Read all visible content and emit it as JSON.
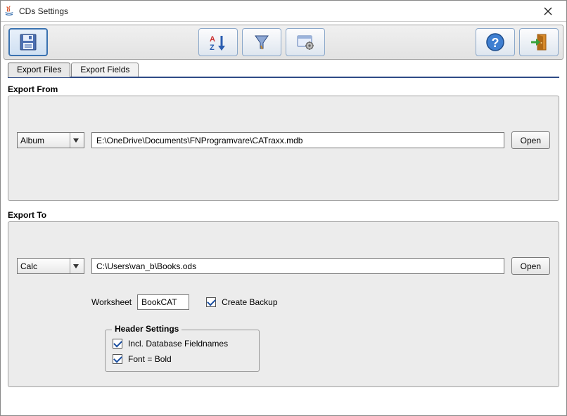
{
  "window": {
    "title": "CDs Settings"
  },
  "toolbar": {
    "save_name": "save-icon",
    "sort_name": "sort-az-icon",
    "filter_name": "funnel-icon",
    "settings_name": "window-gear-icon",
    "help_name": "help-icon",
    "exit_name": "exit-door-icon"
  },
  "tabs": {
    "export_files": "Export Files",
    "export_fields": "Export Fields"
  },
  "from": {
    "title": "Export From",
    "combo": "Album",
    "path": "E:\\OneDrive\\Documents\\FNProgramvare\\CATraxx.mdb",
    "open": "Open"
  },
  "to": {
    "title": "Export To",
    "combo": "Calc",
    "path": "C:\\Users\\van_b\\Books.ods",
    "open": "Open",
    "worksheet_label": "Worksheet",
    "worksheet_value": "BookCAT",
    "create_backup": "Create Backup",
    "header_settings_title": "Header Settings",
    "incl_fieldnames": "Incl. Database Fieldnames",
    "font_bold": "Font = Bold"
  }
}
